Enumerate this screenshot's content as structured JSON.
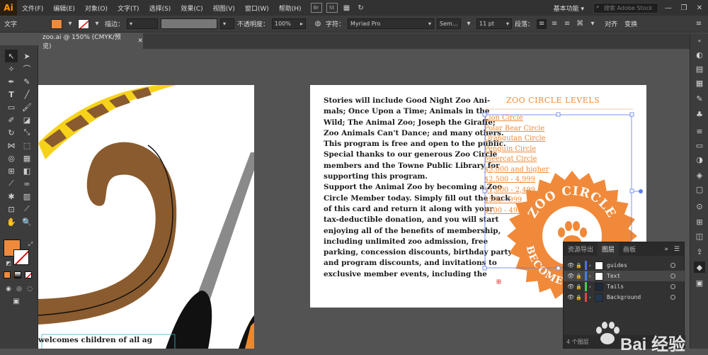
{
  "app": {
    "logo": "Ai"
  },
  "menu": [
    "文件(F)",
    "编辑(E)",
    "对象(O)",
    "文字(T)",
    "选择(S)",
    "效果(C)",
    "视图(V)",
    "窗口(W)",
    "帮助(H)"
  ],
  "menu_badges": [
    "Br",
    "St"
  ],
  "workspace": {
    "label": "基本功能 ▾",
    "search_placeholder": "搜索 Adobe Stock"
  },
  "window_controls": [
    "—",
    "❐",
    "✕"
  ],
  "control_bar": {
    "type_label": "文字",
    "fill_color": "#f08a3a",
    "stroke_label": "描边：",
    "opacity_label": "不透明度：",
    "opacity_value": "100%",
    "char_label": "字符：",
    "font_value": "Myriad Pro",
    "style_value": "Sem...",
    "size_value": "11 pt",
    "para_label": "段落：",
    "align_label": "对齐",
    "transform_label": "变换"
  },
  "document_tab": {
    "title": "zoo.ai @ 150% (CMYK/预览)",
    "close": "✕"
  },
  "artboard2": {
    "body_lines": [
      "Stories will include Good Night Zoo Ani-",
      "mals; Once Upon a Time; Animals in the",
      "Wild; The Animal Zoo; Joseph the Giraffe;",
      "Zoo Animals Can't Dance; and many others.",
      "This program is free and open to the public.",
      "Special thanks to our generous Zoo Circle",
      "members and the Towne Public Library for",
      "supporting this program.",
      "Support the Animal Zoo by becoming a Zoo",
      "Circle Member today. Simply fill out the back",
      "of this card and return it along with your",
      "tax-deductible donation, and you will start",
      "enjoying all of the benefits of membership,",
      "including unlimited zoo admission, free",
      "parking, concession discounts, birthday party",
      "and program discounts, and invitations to",
      "exclusive member events, including the"
    ],
    "levels_title": "ZOO CIRCLE LEVELS",
    "levels": [
      "Lion Circle",
      "Polar Bear Circle",
      "Orangutan Circle",
      "Penguin Circle",
      "Meercat Circle",
      "$5,000  and higher",
      "$2,500 - 4,999",
      "$1,000 - 2,499",
      "$500 - 999",
      "$100 - 499"
    ],
    "seal_top": "ZOO CIRCLE",
    "seal_bottom": "BECOME A MEMBER",
    "seal_color": "#f08a3a"
  },
  "artboard1": {
    "bottom_text": "welcomes children of all ag"
  },
  "layers_panel": {
    "tabs": [
      "资源导出",
      "图层",
      "画板"
    ],
    "active_tab": 1,
    "menu_glyphs": [
      "»",
      "☰"
    ],
    "layers": [
      {
        "name": "guides",
        "color": "#4f6ee8",
        "selected": false
      },
      {
        "name": "Text",
        "color": "#3f7fe8",
        "selected": true
      },
      {
        "name": "Tails",
        "color": "#3fd14a",
        "selected": false
      },
      {
        "name": "Background",
        "color": "#e84242",
        "selected": false
      }
    ],
    "footer": "4 个图层"
  },
  "watermark": {
    "text": "Bai 经验"
  }
}
